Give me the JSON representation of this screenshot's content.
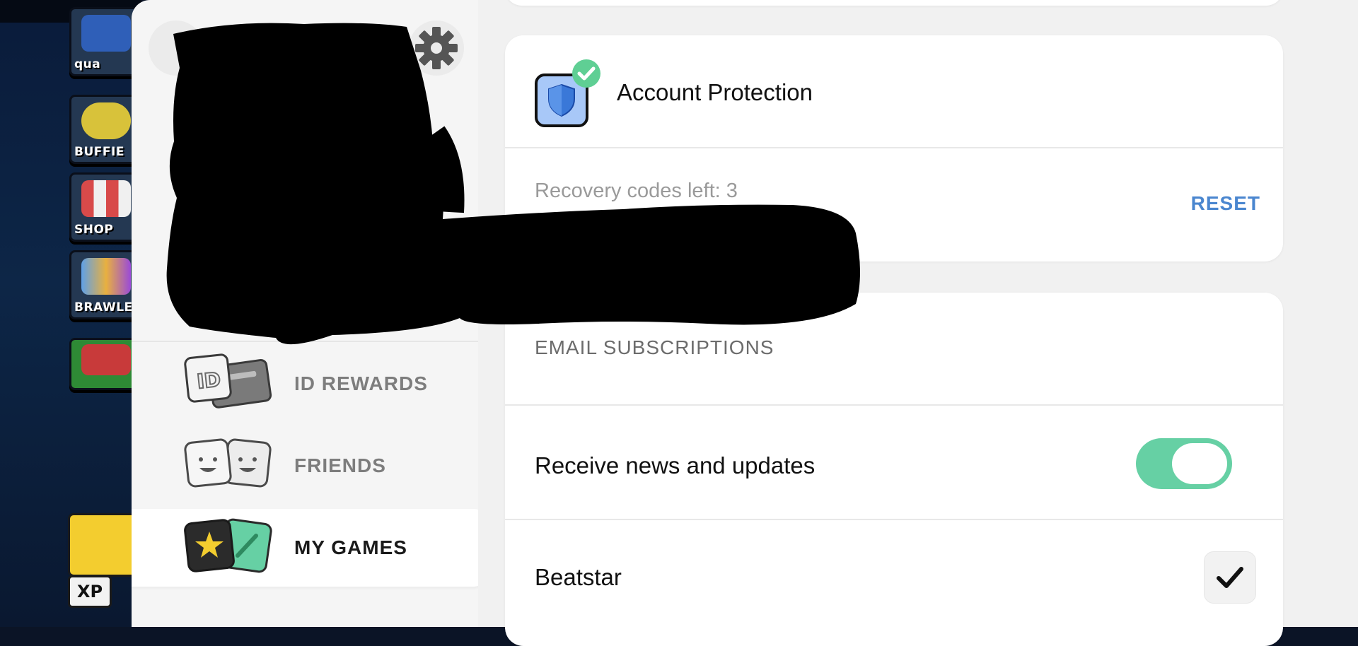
{
  "game": {
    "buttons": [
      {
        "label": "qua"
      },
      {
        "label": "BUFFIE"
      },
      {
        "label": "SHOP"
      },
      {
        "label": "BRAWLE"
      }
    ],
    "xp_label": "XP"
  },
  "sidebar": {
    "items": [
      {
        "label": "ID REWARDS",
        "icon": "id-card-icon"
      },
      {
        "label": "FRIENDS",
        "icon": "friends-faces-icon"
      },
      {
        "label": "MY GAMES",
        "icon": "games-cards-icon",
        "active": true
      }
    ]
  },
  "account_protection": {
    "title": "Account Protection",
    "recovery_text": "Recovery codes left: 3",
    "reset_label": "RESET"
  },
  "email_subscriptions": {
    "section_title": "EMAIL SUBSCRIPTIONS",
    "rows": [
      {
        "label": "Receive news and updates",
        "control": "toggle",
        "on": true
      },
      {
        "label": "Beatstar",
        "control": "checkbox",
        "checked": true
      }
    ]
  },
  "colors": {
    "accent_green": "#66d0a4",
    "link_blue": "#4a86cf",
    "shield_blue": "#3a78d8"
  }
}
